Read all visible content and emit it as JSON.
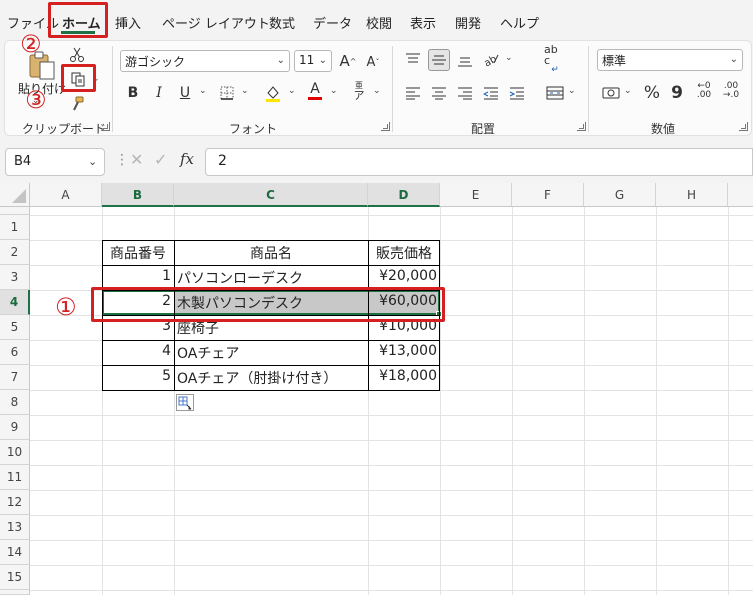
{
  "tabs": [
    "ファイル",
    "ホーム",
    "挿入",
    "ページ レイアウト",
    "数式",
    "データ",
    "校閲",
    "表示",
    "開発",
    "ヘルプ"
  ],
  "ribbon": {
    "clipboard": {
      "group_label": "クリップボード",
      "paste_label": "貼り付け"
    },
    "font": {
      "group_label": "フォント",
      "font_name": "游ゴシック",
      "font_size": "11",
      "grow_label": "A",
      "shrink_label": "A",
      "bold": "B",
      "italic": "I",
      "underline": "U",
      "font_color_letter": "A",
      "phonetic_small": "亜",
      "phonetic_big": "ア"
    },
    "alignment": {
      "group_label": "配置",
      "wrap_label": "ab c"
    },
    "number": {
      "group_label": "数値",
      "format": "標準",
      "percent": "%",
      "comma": "9",
      "inc_top": "←0",
      "inc_bottom": ".00",
      "dec_top": ".00",
      "dec_bottom": "→.0"
    }
  },
  "formula_bar": {
    "name_box": "B4",
    "fx": "fx",
    "value": "2"
  },
  "columns": [
    "A",
    "B",
    "C",
    "D",
    "E",
    "F",
    "G",
    "H"
  ],
  "rows": [
    "1",
    "2",
    "3",
    "4",
    "5",
    "6",
    "7",
    "8",
    "9",
    "10",
    "11",
    "12",
    "13",
    "14",
    "15",
    "16"
  ],
  "table": {
    "headers": [
      "商品番号",
      "商品名",
      "販売価格"
    ],
    "rows": [
      [
        "1",
        "パソコンローデスク",
        "¥20,000"
      ],
      [
        "2",
        "木製パソコンデスク",
        "¥60,000"
      ],
      [
        "3",
        "座椅子",
        "¥10,000"
      ],
      [
        "4",
        "OAチェア",
        "¥13,000"
      ],
      [
        "5",
        "OAチェア（肘掛け付き）",
        "¥18,000"
      ]
    ]
  },
  "annotations": {
    "step1": "①",
    "step2": "②",
    "step3": "③"
  },
  "colors": {
    "accent": "#1e7145",
    "callout": "#d42020",
    "selection_fill": "#c8c8c8"
  }
}
